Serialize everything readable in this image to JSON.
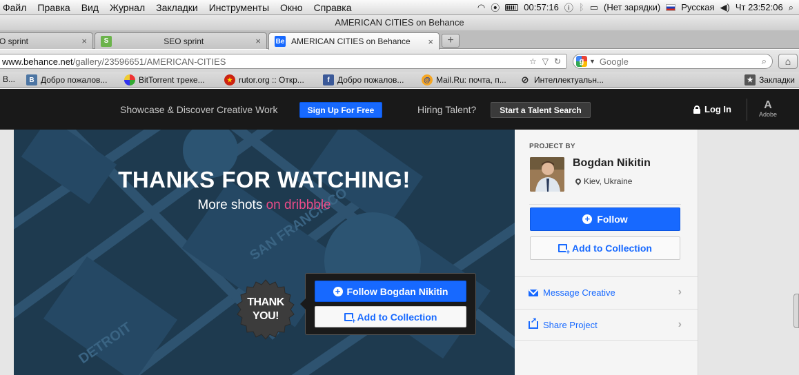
{
  "menubar": {
    "items": [
      "Файл",
      "Правка",
      "Вид",
      "Журнал",
      "Закладки",
      "Инструменты",
      "Окно",
      "Справка"
    ],
    "time_remaining": "00:57:16",
    "power_status": "(Нет зарядки)",
    "input_language": "Русская",
    "clock": "Чт 23:52:06"
  },
  "window": {
    "title": "AMERICAN CITIES on Behance"
  },
  "tabs": [
    {
      "label": "O sprint"
    },
    {
      "label": "SEO sprint"
    },
    {
      "label": "AMERICAN CITIES on Behance"
    }
  ],
  "tab_icons": {
    "seo": "S",
    "behance": "Be",
    "close": "×",
    "new_tab": "+"
  },
  "urlbar": {
    "host": "www.behance.net",
    "path": "/gallery/23596651/AMERICAN-CITIES"
  },
  "searchbar": {
    "placeholder": "Google",
    "engine_letter": "g"
  },
  "bookmarks": [
    {
      "label": "В..."
    },
    {
      "label": "Добро пожалов..."
    },
    {
      "label": "BitTorrent треке..."
    },
    {
      "label": "rutor.org :: Откр..."
    },
    {
      "label": "Добро пожалов..."
    },
    {
      "label": "Mail.Ru: почта, п..."
    },
    {
      "label": "Интеллектуальн..."
    }
  ],
  "bookmarks_menu_label": "Закладки",
  "behance_header": {
    "tagline": "Showcase & Discover Creative Work",
    "signup_label": "Sign Up For Free",
    "hiring_text": "Hiring Talent?",
    "talent_search_label": "Start a Talent Search",
    "login_label": "Log In",
    "adobe_label": "Adobe"
  },
  "artwork": {
    "title": "THANKS FOR WATCHING!",
    "subtitle_prefix": "More shots ",
    "subtitle_link": "on dribbble",
    "badge_line1": "THANK",
    "badge_line2": "YOU!",
    "map_labels": [
      "SAN FRANCISCO",
      "DETROIT"
    ]
  },
  "popup": {
    "follow_label": "Follow Bogdan Nikitin",
    "collection_label": "Add to Collection"
  },
  "sidebar": {
    "project_by_label": "PROJECT BY",
    "owner_name": "Bogdan Nikitin",
    "owner_location": "Kiev, Ukraine",
    "follow_label": "Follow",
    "collection_label": "Add to Collection",
    "message_label": "Message Creative",
    "share_label": "Share Project"
  },
  "colors": {
    "behance_blue": "#1769ff",
    "dribbble_pink": "#ea4c89",
    "header_bg": "#191919",
    "artwork_bg": "#1e3a4f"
  }
}
